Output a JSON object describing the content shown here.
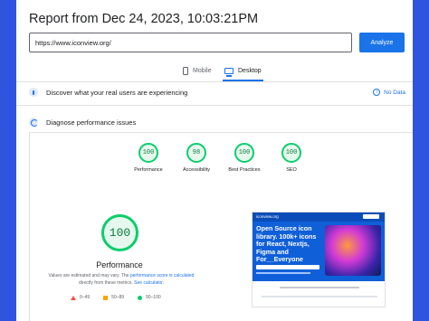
{
  "header": {
    "title": "Report from Dec 24, 2023, 10:03:21PM"
  },
  "url_bar": {
    "value": "https://www.iconview.org/",
    "analyze_label": "Analyze"
  },
  "tabs": [
    {
      "label": "Mobile",
      "icon": "phone-icon",
      "selected": false
    },
    {
      "label": "Desktop",
      "icon": "monitor-icon",
      "selected": true
    }
  ],
  "sections": {
    "field": {
      "label": "Discover what your real users are experiencing",
      "status": "No Data",
      "status_icon": "info-icon"
    },
    "lab": {
      "label": "Diagnose performance issues",
      "icon": "gauge-icon"
    }
  },
  "scores": [
    {
      "label": "Performance",
      "value": "100"
    },
    {
      "label": "Accessibility",
      "value": "98"
    },
    {
      "label": "Best Practices",
      "value": "100"
    },
    {
      "label": "SEO",
      "value": "100"
    }
  ],
  "performance": {
    "score": "100",
    "title": "Performance",
    "note_prefix": "Values are estimated and may vary. The",
    "note_link1": "performance score is calculated",
    "note_middle": "directly from these metrics.",
    "note_link2": "See calculator."
  },
  "legend": [
    {
      "range": "0–49",
      "shape": "triangle",
      "color": "#ff4e42"
    },
    {
      "range": "50–89",
      "shape": "square",
      "color": "#ffa400"
    },
    {
      "range": "90–100",
      "shape": "circle",
      "color": "#0cce6b"
    }
  ],
  "screenshot_preview": {
    "logo": "iconview.org",
    "headline": "Open Source icon library. 100k+ icons for React, Nextjs, Figma and For__Everyone"
  },
  "colors": {
    "background": "#2f55e0",
    "accent": "#1a73e8",
    "pass": "#0cce6b"
  }
}
